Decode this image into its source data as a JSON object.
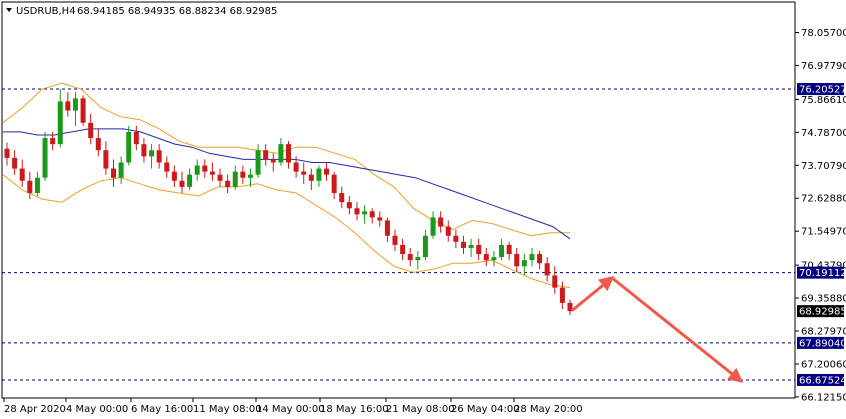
{
  "header": {
    "symbol": "USDRUB,H4",
    "ohlc": "68.94185 68.94935 68.88234 68.92985"
  },
  "colors": {
    "bull": "#1a9a1a",
    "bear": "#cc1a1a",
    "bollinger": "#f0a020",
    "moving_average": "#1e2aa8",
    "level_line": "#000080",
    "level_label_bg": "#000080",
    "price_label_bg": "#000000",
    "arrow": "#f05a4a"
  },
  "chart_data": {
    "type": "candlestick",
    "x_labels": [
      "28 Apr 2020",
      "4 May 00:00",
      "6 May 16:00",
      "11 May 08:00",
      "14 May 00:00",
      "18 May 16:00",
      "21 May 08:00",
      "26 May 04:00",
      "28 May 20:00"
    ],
    "ylim": [
      66.1215,
      79.1
    ],
    "y_ticks": [
      "78.05700",
      "76.97790",
      "75.86610",
      "74.78700",
      "73.70790",
      "72.62880",
      "71.54970",
      "70.43790",
      "69.35880",
      "68.27970",
      "67.20060",
      "66.12150"
    ],
    "level_lines": [
      {
        "value": 76.20527,
        "label": "76.20527",
        "style": "label"
      },
      {
        "value": 70.19112,
        "label": "70.19112",
        "style": "label"
      },
      {
        "value": 67.8904,
        "label": "67.89040",
        "style": "label"
      },
      {
        "value": 66.67524,
        "label": "66.67524",
        "style": "label"
      }
    ],
    "current_price": {
      "value": 68.92985,
      "label": "68.92985"
    },
    "candles": [
      [
        74.25,
        74.45,
        73.7,
        73.95
      ],
      [
        73.95,
        74.2,
        73.4,
        73.6
      ],
      [
        73.6,
        73.9,
        73.0,
        73.2
      ],
      [
        73.2,
        73.5,
        72.6,
        72.8
      ],
      [
        72.8,
        73.5,
        72.7,
        73.3
      ],
      [
        73.3,
        74.8,
        73.2,
        74.6
      ],
      [
        74.6,
        74.8,
        74.2,
        74.4
      ],
      [
        74.4,
        76.2,
        74.3,
        75.8
      ],
      [
        75.8,
        76.1,
        75.3,
        75.5
      ],
      [
        75.5,
        76.1,
        75.0,
        75.9
      ],
      [
        75.9,
        76.0,
        75.0,
        75.1
      ],
      [
        75.1,
        75.4,
        74.4,
        74.6
      ],
      [
        74.6,
        74.9,
        74.0,
        74.2
      ],
      [
        74.2,
        74.5,
        73.4,
        73.6
      ],
      [
        73.6,
        73.9,
        73.0,
        73.3
      ],
      [
        73.3,
        74.0,
        73.1,
        73.8
      ],
      [
        73.8,
        75.0,
        73.7,
        74.8
      ],
      [
        74.8,
        75.0,
        74.2,
        74.4
      ],
      [
        74.4,
        74.6,
        73.8,
        74.0
      ],
      [
        74.0,
        74.4,
        73.6,
        74.2
      ],
      [
        74.2,
        74.4,
        73.6,
        73.8
      ],
      [
        73.8,
        74.0,
        73.3,
        73.5
      ],
      [
        73.5,
        73.7,
        73.0,
        73.2
      ],
      [
        73.2,
        73.5,
        72.8,
        73.0
      ],
      [
        73.0,
        73.6,
        72.9,
        73.4
      ],
      [
        73.4,
        73.9,
        73.2,
        73.7
      ],
      [
        73.7,
        73.9,
        73.3,
        73.5
      ],
      [
        73.5,
        73.8,
        73.2,
        73.4
      ],
      [
        73.4,
        73.6,
        73.0,
        73.2
      ],
      [
        73.2,
        73.4,
        72.8,
        73.0
      ],
      [
        73.0,
        73.7,
        72.9,
        73.5
      ],
      [
        73.5,
        73.7,
        73.1,
        73.3
      ],
      [
        73.3,
        73.6,
        73.0,
        73.4
      ],
      [
        73.4,
        74.4,
        73.3,
        74.2
      ],
      [
        74.2,
        74.4,
        73.7,
        73.9
      ],
      [
        73.9,
        74.1,
        73.5,
        73.8
      ],
      [
        73.8,
        74.6,
        73.7,
        74.4
      ],
      [
        74.4,
        74.5,
        73.6,
        73.8
      ],
      [
        73.8,
        74.0,
        73.3,
        73.5
      ],
      [
        73.5,
        73.8,
        73.1,
        73.4
      ],
      [
        73.4,
        73.6,
        72.9,
        73.2
      ],
      [
        73.2,
        73.7,
        73.0,
        73.6
      ],
      [
        73.6,
        73.8,
        73.2,
        73.4
      ],
      [
        73.4,
        73.5,
        72.6,
        72.8
      ],
      [
        72.8,
        73.0,
        72.3,
        72.5
      ],
      [
        72.5,
        72.7,
        72.1,
        72.3
      ],
      [
        72.3,
        72.5,
        71.9,
        72.1
      ],
      [
        72.1,
        72.4,
        71.8,
        72.2
      ],
      [
        72.2,
        72.3,
        71.8,
        72.0
      ],
      [
        72.0,
        72.2,
        71.7,
        71.9
      ],
      [
        71.9,
        72.0,
        71.2,
        71.4
      ],
      [
        71.4,
        71.6,
        70.9,
        71.1
      ],
      [
        71.1,
        71.3,
        70.6,
        70.8
      ],
      [
        70.8,
        71.0,
        70.4,
        70.6
      ],
      [
        70.6,
        70.9,
        70.3,
        70.7
      ],
      [
        70.7,
        71.6,
        70.6,
        71.4
      ],
      [
        71.4,
        72.2,
        71.3,
        72.0
      ],
      [
        72.0,
        72.2,
        71.5,
        71.7
      ],
      [
        71.7,
        71.9,
        71.2,
        71.4
      ],
      [
        71.4,
        71.6,
        71.0,
        71.2
      ],
      [
        71.2,
        71.4,
        70.8,
        71.0
      ],
      [
        71.0,
        71.3,
        70.7,
        71.1
      ],
      [
        71.1,
        71.3,
        70.6,
        70.8
      ],
      [
        70.8,
        71.0,
        70.4,
        70.6
      ],
      [
        70.6,
        70.9,
        70.4,
        70.7
      ],
      [
        70.7,
        71.3,
        70.6,
        71.1
      ],
      [
        71.1,
        71.2,
        70.6,
        70.8
      ],
      [
        70.8,
        71.0,
        70.2,
        70.4
      ],
      [
        70.4,
        70.8,
        70.1,
        70.6
      ],
      [
        70.6,
        71.0,
        70.4,
        70.8
      ],
      [
        70.8,
        70.9,
        70.3,
        70.5
      ],
      [
        70.5,
        70.7,
        69.9,
        70.1
      ],
      [
        70.1,
        70.4,
        69.5,
        69.7
      ],
      [
        69.7,
        69.9,
        69.0,
        69.2
      ],
      [
        69.2,
        69.3,
        68.8,
        68.93
      ]
    ],
    "ma": [
      74.8,
      74.8,
      74.7,
      74.7,
      74.8,
      74.9,
      74.9,
      74.9,
      74.8,
      74.6,
      74.4,
      74.3,
      74.1,
      74.0,
      73.9,
      73.9,
      73.9,
      73.9,
      73.8,
      73.8,
      73.7,
      73.6,
      73.5,
      73.4,
      73.3,
      73.1,
      72.9,
      72.7,
      72.5,
      72.3,
      72.1,
      71.9,
      71.7,
      71.3
    ],
    "bb_upper": [
      75.1,
      75.6,
      76.2,
      76.4,
      76.2,
      75.6,
      75.3,
      75.2,
      74.9,
      74.5,
      74.3,
      74.3,
      74.3,
      74.2,
      74.1,
      74.3,
      74.3,
      74.1,
      73.9,
      73.4,
      73.0,
      72.3,
      71.9,
      71.6,
      71.9,
      71.8,
      71.6,
      71.4,
      71.5,
      71.5
    ],
    "bb_lower": [
      73.4,
      72.9,
      72.6,
      72.5,
      72.9,
      73.2,
      73.3,
      73.1,
      72.9,
      72.8,
      72.7,
      73.0,
      73.0,
      73.1,
      72.9,
      72.8,
      72.4,
      72.0,
      71.5,
      70.9,
      70.4,
      70.2,
      70.3,
      70.5,
      70.5,
      70.6,
      70.3,
      70.0,
      69.8,
      69.7
    ],
    "arrows": [
      {
        "from": [
          68.95,
          572
        ],
        "to": [
          70.02,
          612
        ]
      },
      {
        "from": [
          70.02,
          612
        ],
        "to": [
          66.64,
          741
        ]
      }
    ]
  }
}
